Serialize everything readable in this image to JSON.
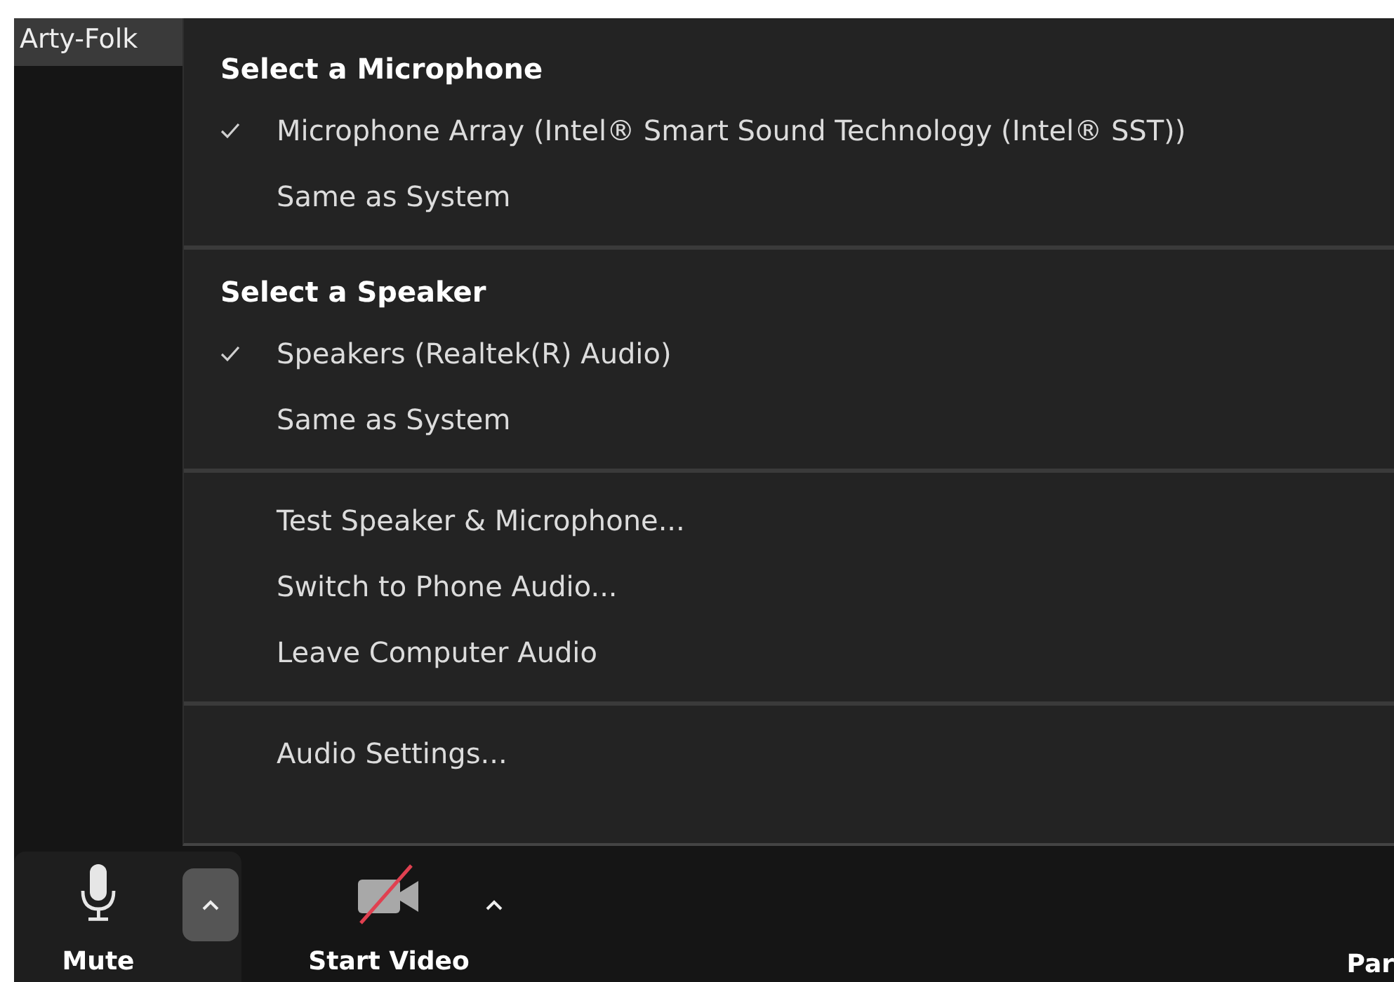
{
  "participant_label": "Arty-Folk",
  "audio_menu": {
    "sections": [
      {
        "heading": "Select a Microphone",
        "items": [
          {
            "label": "Microphone Array (Intel® Smart Sound Technology (Intel® SST))",
            "checked": true
          },
          {
            "label": "Same as System",
            "checked": false
          }
        ]
      },
      {
        "heading": "Select a Speaker",
        "items": [
          {
            "label": "Speakers (Realtek(R) Audio)",
            "checked": true
          },
          {
            "label": "Same as System",
            "checked": false
          }
        ]
      },
      {
        "items": [
          {
            "label": "Test Speaker & Microphone...",
            "checked": false
          },
          {
            "label": "Switch to Phone Audio...",
            "checked": false
          },
          {
            "label": "Leave Computer Audio",
            "checked": false
          }
        ]
      },
      {
        "items": [
          {
            "label": "Audio Settings...",
            "checked": false
          }
        ]
      }
    ]
  },
  "toolbar": {
    "buttons": [
      {
        "kind": "mic",
        "label": "Mute",
        "caret_selected": true
      },
      {
        "kind": "video",
        "label": "Start Video",
        "caret_selected": false
      },
      {
        "kind": "text",
        "label": "Par"
      }
    ]
  }
}
